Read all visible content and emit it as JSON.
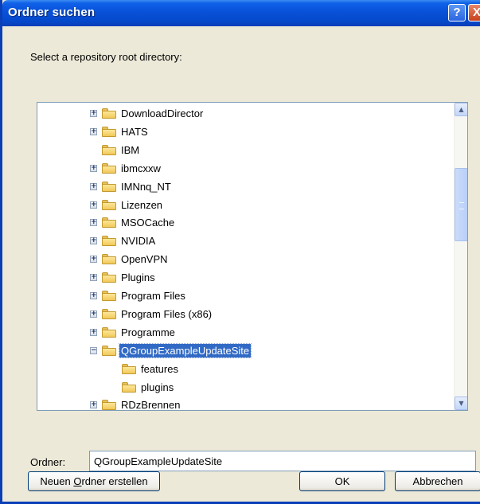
{
  "window": {
    "title": "Ordner suchen",
    "help_glyph": "?",
    "close_glyph": "X"
  },
  "instruction": "Select a repository root directory:",
  "tree": {
    "items": [
      {
        "label": "DownloadDirector",
        "expander": "plus",
        "indent": 0,
        "selected": false
      },
      {
        "label": "HATS",
        "expander": "plus",
        "indent": 0,
        "selected": false
      },
      {
        "label": "IBM",
        "expander": "none",
        "indent": 0,
        "selected": false
      },
      {
        "label": "ibmcxxw",
        "expander": "plus",
        "indent": 0,
        "selected": false
      },
      {
        "label": "IMNnq_NT",
        "expander": "plus",
        "indent": 0,
        "selected": false
      },
      {
        "label": "Lizenzen",
        "expander": "plus",
        "indent": 0,
        "selected": false
      },
      {
        "label": "MSOCache",
        "expander": "plus",
        "indent": 0,
        "selected": false
      },
      {
        "label": "NVIDIA",
        "expander": "plus",
        "indent": 0,
        "selected": false
      },
      {
        "label": "OpenVPN",
        "expander": "plus",
        "indent": 0,
        "selected": false
      },
      {
        "label": "Plugins",
        "expander": "plus",
        "indent": 0,
        "selected": false
      },
      {
        "label": "Program Files",
        "expander": "plus",
        "indent": 0,
        "selected": false
      },
      {
        "label": "Program Files (x86)",
        "expander": "plus",
        "indent": 0,
        "selected": false
      },
      {
        "label": "Programme",
        "expander": "plus",
        "indent": 0,
        "selected": false
      },
      {
        "label": "QGroupExampleUpdateSite",
        "expander": "minus",
        "indent": 0,
        "selected": true
      },
      {
        "label": "features",
        "expander": "none",
        "indent": 1,
        "selected": false
      },
      {
        "label": "plugins",
        "expander": "none",
        "indent": 1,
        "selected": false
      },
      {
        "label": "RDzBrennen",
        "expander": "plus",
        "indent": 0,
        "selected": false
      }
    ],
    "scroll_position": 0.35
  },
  "folder_field": {
    "label": "Ordner:",
    "value": "QGroupExampleUpdateSite"
  },
  "buttons": {
    "new_folder": {
      "pre": "Neuen ",
      "mnemonic": "O",
      "post": "rdner erstellen"
    },
    "ok": "OK",
    "cancel": "Abbrechen"
  }
}
